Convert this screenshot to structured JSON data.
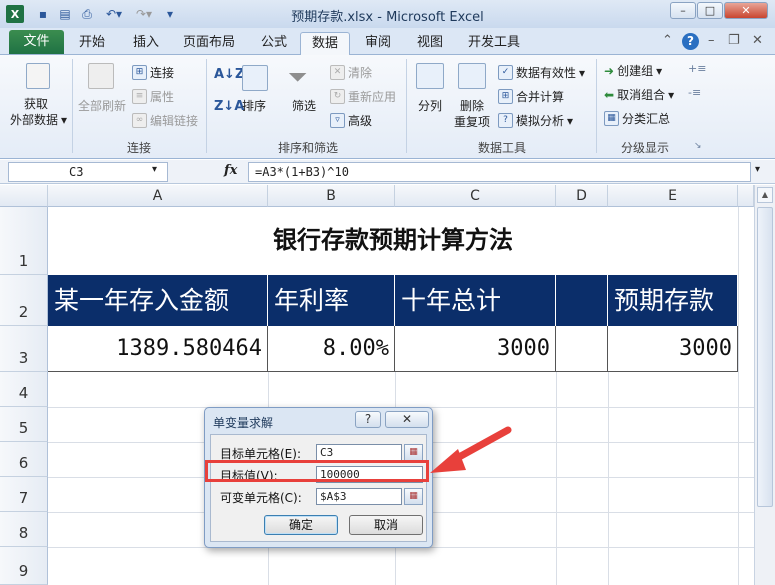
{
  "window": {
    "title": "预期存款.xlsx - Microsoft Excel",
    "app_icon": "X",
    "quick_access": [
      "save-icon",
      "print-preview-icon",
      "print-icon",
      "undo-icon",
      "redo-icon",
      "customize-icon"
    ],
    "controls": {
      "minimize": "–",
      "maximize": "□",
      "close": "✕"
    }
  },
  "tabs": {
    "file": "文件",
    "items": [
      "开始",
      "插入",
      "页面布局",
      "公式",
      "数据",
      "审阅",
      "视图",
      "开发工具"
    ],
    "active": "数据"
  },
  "ribbon": {
    "get_external": {
      "label1": "获取",
      "label2": "外部数据"
    },
    "connections": {
      "refresh_all": "全部刷新",
      "connections": "连接",
      "properties": "属性",
      "edit_links": "编辑链接",
      "group_label": "连接"
    },
    "sort_filter": {
      "sort": "排序",
      "filter": "筛选",
      "clear": "清除",
      "reapply": "重新应用",
      "advanced": "高级",
      "group_label": "排序和筛选"
    },
    "data_tools": {
      "text_to_columns": "分列",
      "remove_dup_1": "删除",
      "remove_dup_2": "重复项",
      "data_validation": "数据有效性",
      "consolidate": "合并计算",
      "what_if": "模拟分析",
      "group_label": "数据工具"
    },
    "outline": {
      "group": "创建组",
      "ungroup": "取消组合",
      "subtotal": "分类汇总",
      "group_label": "分级显示"
    }
  },
  "formula_bar": {
    "name_box": "C3",
    "fx": "fx",
    "formula": "=A3*(1+B3)^10"
  },
  "sheet": {
    "columns": [
      "A",
      "B",
      "C",
      "D",
      "E"
    ],
    "rows": [
      "1",
      "2",
      "3",
      "4",
      "5",
      "6",
      "7",
      "8",
      "9"
    ],
    "title": "银行存款预期计算方法",
    "headers": {
      "A": "某一年存入金额",
      "B": "年利率",
      "C": "十年总计",
      "E": "预期存款"
    },
    "values": {
      "A": "1389.580464",
      "B": "8.00%",
      "C": "3000",
      "E": "3000"
    },
    "header_bg": "#0B2E6A"
  },
  "dialog": {
    "title": "单变量求解",
    "help": "?",
    "close": "✕",
    "set_cell_label": "目标单元格(E):",
    "set_cell_value": "C3",
    "to_value_label": "目标值(V):",
    "to_value_value": "100000",
    "changing_cell_label": "可变单元格(C):",
    "changing_cell_value": "$A$3",
    "ok": "确定",
    "cancel": "取消"
  },
  "annotation": {
    "color": "#E8403B"
  }
}
